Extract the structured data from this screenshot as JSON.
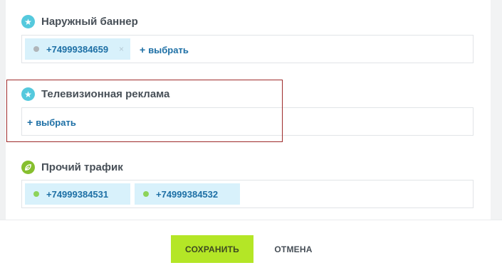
{
  "sections": [
    {
      "title": "Наружный баннер",
      "icon": "star-icon",
      "tags": [
        {
          "phone": "+74999384659",
          "dot_color": "#b0b5b9",
          "removable": true
        }
      ],
      "add_label": "выбрать"
    },
    {
      "title": "Телевизионная реклама",
      "icon": "star-icon",
      "tags": [],
      "add_label": "выбрать"
    },
    {
      "title": "Прочий трафик",
      "icon": "leaf-icon",
      "tags": [
        {
          "phone": "+74999384531",
          "dot_color": "#8dd35a"
        },
        {
          "phone": "+74999384532",
          "dot_color": "#8dd35a"
        }
      ]
    }
  ],
  "add_symbol": "+",
  "remove_symbol": "×",
  "footer": {
    "save_label": "СОХРАНИТЬ",
    "cancel_label": "ОТМЕНА"
  },
  "colors": {
    "accent_green": "#b4e626",
    "link_blue": "#1d6fa5",
    "tag_bg": "#d8f1fb",
    "highlight_border": "#9e2a2a"
  }
}
